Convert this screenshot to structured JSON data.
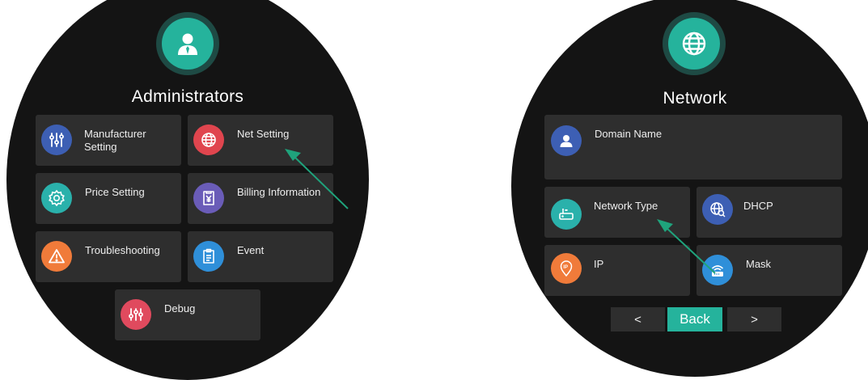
{
  "admin_screen": {
    "title": "Administrators",
    "header_icon": "admin-user-icon",
    "tiles": [
      {
        "label_line1": "Manufacturer",
        "label_line2": "Setting",
        "icon": "sliders-icon",
        "color": "#3d5fb4"
      },
      {
        "label": "Net Setting",
        "icon": "globe-icon",
        "color": "#e0454e"
      },
      {
        "label": "Price Setting",
        "icon": "gear-icon",
        "color": "#2ab1ab"
      },
      {
        "label": "Billing Information",
        "icon": "billing-yen-icon",
        "color": "#6a5cb8"
      },
      {
        "label": "Troubleshooting",
        "icon": "warning-icon",
        "color": "#f07b3a"
      },
      {
        "label": "Event",
        "icon": "clipboard-icon",
        "color": "#2f8fd9"
      },
      {
        "label": "Debug",
        "icon": "equalizer-icon",
        "color": "#e04a5e"
      }
    ]
  },
  "network_screen": {
    "title": "Network",
    "header_icon": "globe-icon",
    "tiles": [
      {
        "label": "Domain Name",
        "icon": "user-icon",
        "color": "#3d5fb4"
      },
      {
        "label": "Network Type",
        "icon": "router-icon",
        "color": "#2ab1ab"
      },
      {
        "label": "DHCP",
        "icon": "globe-search-icon",
        "color": "#3d5fb4"
      },
      {
        "label": "IP",
        "icon": "ip-pin-icon",
        "color": "#f07b3a"
      },
      {
        "label": "Mask",
        "icon": "wifi-router-icon",
        "color": "#2f8fd9"
      }
    ],
    "nav": {
      "prev": "<",
      "back": "Back",
      "next": ">"
    }
  },
  "colors": {
    "accent": "#25b39c",
    "screen_bg": "#141414",
    "tile_bg": "#2e2e2e",
    "pointer_arrow": "#1fa37c"
  }
}
